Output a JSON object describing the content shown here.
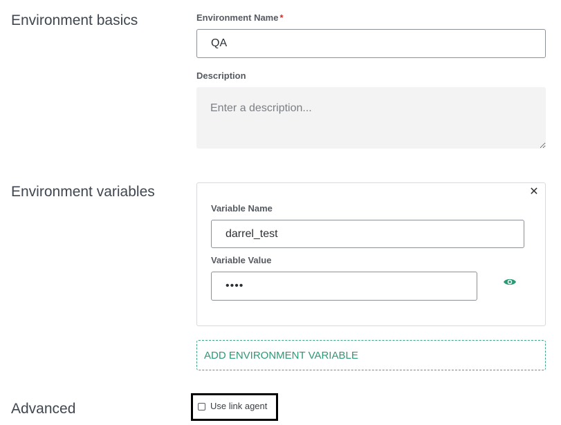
{
  "sections": {
    "basics_title": "Environment basics",
    "variables_title": "Environment variables",
    "advanced_title": "Advanced"
  },
  "basics": {
    "name_label": "Environment Name",
    "required_mark": "*",
    "name_value": "QA",
    "description_label": "Description",
    "description_placeholder": "Enter a description..."
  },
  "variable": {
    "name_label": "Variable Name",
    "name_value": "darrel_test",
    "value_label": "Variable Value",
    "value_masked": "••••",
    "close_glyph": "✕",
    "reveal_icon": "eye-icon"
  },
  "add_variable_label": "ADD ENVIRONMENT VARIABLE",
  "advanced": {
    "use_link_agent_label": "Use link agent",
    "use_link_agent_checked": false
  },
  "colors": {
    "accent": "#2a9a74",
    "required": "#d22c2c",
    "highlight_border": "#000000"
  }
}
